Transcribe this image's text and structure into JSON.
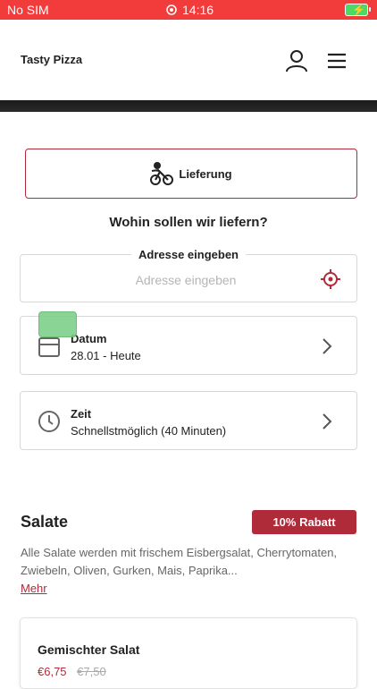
{
  "status_bar": {
    "carrier": "No SIM",
    "time": "14:16",
    "alarm_icon": "alarm-icon",
    "battery_icon": "battery-charging-icon"
  },
  "header": {
    "brand": "Tasty Pizza",
    "user_icon": "user-icon",
    "menu_icon": "hamburger-menu-icon"
  },
  "delivery": {
    "label": "Lieferung",
    "icon": "bike-rider-icon"
  },
  "address": {
    "question": "Wohin sollen wir liefern?",
    "legend": "Adresse eingeben",
    "placeholder": "Adresse eingeben",
    "value": "",
    "locate_icon": "crosshair-icon"
  },
  "date": {
    "title": "Datum",
    "value": "28.01 - Heute",
    "icon": "calendar-icon"
  },
  "time": {
    "title": "Zeit",
    "value": "Schnellstmöglich (40 Minuten)",
    "icon": "clock-icon"
  },
  "section": {
    "title": "Salate",
    "badge": "10% Rabatt",
    "description": "Alle Salate werden mit frischem Eisbergsalat, Cherrytomaten, Zwiebeln, Oliven, Gurken, Mais, Paprika...",
    "more": "Mehr"
  },
  "product": {
    "name": "Gemischter Salat",
    "price": "€6,75",
    "old_price": "€7,50"
  },
  "colors": {
    "status_bar": "#f23b3b",
    "accent": "#b02b3a",
    "overlay": "#7ed08a"
  }
}
